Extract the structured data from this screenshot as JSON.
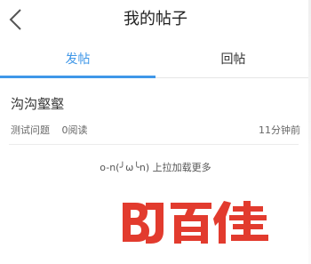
{
  "header": {
    "title": "我的帖子",
    "back_icon": "chevron-left-icon"
  },
  "tabs": [
    {
      "label": "发帖",
      "active": true
    },
    {
      "label": "回帖",
      "active": false
    }
  ],
  "accent_color": "#3f97e8",
  "post": {
    "title": "沟沟壑壑",
    "category": "测试问题",
    "reads": "0阅读",
    "time": "11分钟前"
  },
  "load_more_text": "o-n(╯ω╰n) 上拉加载更多",
  "watermark": {
    "text": "BJ百佳",
    "color": "#e23b2e"
  }
}
